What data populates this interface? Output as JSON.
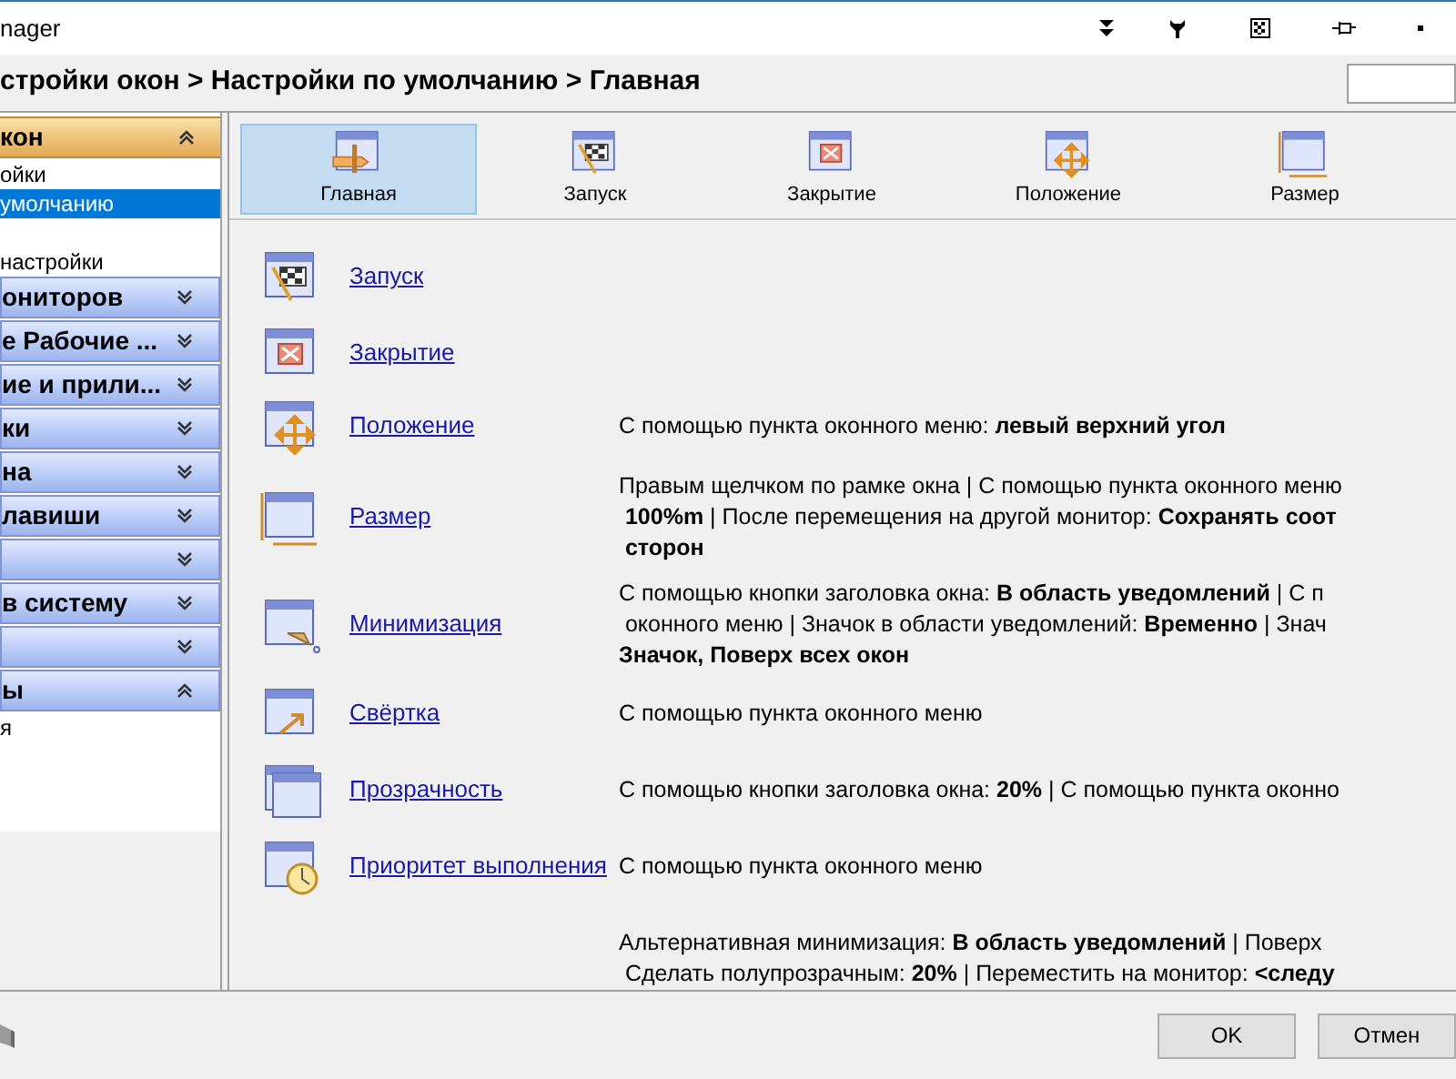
{
  "window": {
    "title": "nager"
  },
  "breadcrumb": "стройки окон > Настройки по умолчанию > Главная",
  "sidebar": {
    "panels": [
      {
        "label": "кон",
        "selected": true,
        "expanded": true,
        "items": [
          {
            "label": "ойки",
            "selected": false
          },
          {
            "label": "умолчанию",
            "selected": true
          },
          {
            "label": "настройки",
            "selected": false
          }
        ]
      },
      {
        "label": "ониторов",
        "selected": false,
        "expanded": false
      },
      {
        "label": "е Рабочие ...",
        "selected": false,
        "expanded": false
      },
      {
        "label": "ие и прили...",
        "selected": false,
        "expanded": false
      },
      {
        "label": "ки",
        "selected": false,
        "expanded": false
      },
      {
        "label": "на",
        "selected": false,
        "expanded": false
      },
      {
        "label": "лавиши",
        "selected": false,
        "expanded": false
      },
      {
        "selected": false,
        "expanded": false
      },
      {
        "label": "в систему",
        "selected": false,
        "expanded": false
      },
      {
        "selected": false,
        "expanded": false
      },
      {
        "label": "ы",
        "selected": false,
        "expanded": true,
        "items": [
          {
            "label": "я",
            "selected": false
          }
        ]
      }
    ]
  },
  "tabs": [
    {
      "label": "Главная",
      "selected": true
    },
    {
      "label": "Запуск",
      "selected": false
    },
    {
      "label": "Закрытие",
      "selected": false
    },
    {
      "label": "Положение",
      "selected": false
    },
    {
      "label": "Размер",
      "selected": false
    }
  ],
  "rows": [
    {
      "label": "Запуск"
    },
    {
      "label": "Закрытие"
    },
    {
      "label": "Положение",
      "description": [
        "С помощью пункта оконного меню: **левый верхний угол**"
      ]
    },
    {
      "label": "Размер",
      "description": [
        "Правым щелчком по рамке окна | С помощью пункта оконного меню",
        " **100%m** | После перемещения на другой монитор: **Сохранять соот**",
        " **сторон**"
      ]
    },
    {
      "label": "Минимизация",
      "description": [
        "С помощью кнопки заголовка окна: **В область уведомлений** | С п",
        " оконного меню | Значок в области уведомлений: **Временно** | Знач",
        "**Значок, Поверх всех окон**"
      ]
    },
    {
      "label": "Свёртка",
      "description": [
        "С помощью пункта оконного меню"
      ]
    },
    {
      "label": "Прозрачность",
      "description": [
        "С помощью кнопки заголовка окна: **20%** | С помощью пункта оконно"
      ]
    },
    {
      "label": "Приоритет выполнения",
      "description": [
        "С помощью пункта оконного меню"
      ]
    },
    {
      "description": [
        "Альтернативная минимизация: **В область уведомлений** | Поверх",
        " Сделать полупрозрачным: **20%** | Переместить на монитор: **<следу**"
      ]
    }
  ],
  "buttons": [
    "OK",
    "Отмен"
  ]
}
